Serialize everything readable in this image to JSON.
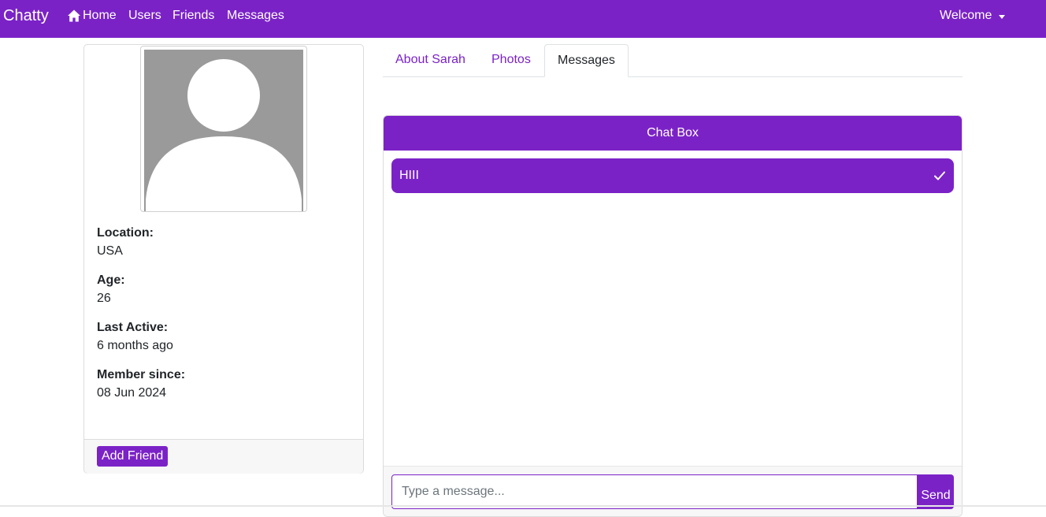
{
  "colors": {
    "brand": "#7b22c7",
    "text": "#212529"
  },
  "navbar": {
    "brand": "Chatty",
    "links": [
      {
        "label": "Home",
        "icon": "home-icon"
      },
      {
        "label": "Users"
      },
      {
        "label": "Friends"
      },
      {
        "label": "Messages"
      }
    ],
    "welcome": "Welcome"
  },
  "profile": {
    "avatar_icon": "user-silhouette",
    "fields": [
      {
        "label": "Location:",
        "value": "USA"
      },
      {
        "label": "Age:",
        "value": "26"
      },
      {
        "label": "Last Active:",
        "value": "6 months ago"
      },
      {
        "label": "Member since:",
        "value": "08 Jun 2024"
      }
    ],
    "add_friend": "Add Friend"
  },
  "tabs": [
    {
      "label": "About Sarah",
      "active": false
    },
    {
      "label": "Photos",
      "active": false
    },
    {
      "label": "Messages",
      "active": true
    }
  ],
  "chat": {
    "title": "Chat Box",
    "messages": [
      {
        "text": "HIII",
        "status_icon": "check-icon"
      }
    ],
    "input_placeholder": "Type a message...",
    "send_label": "Send"
  }
}
